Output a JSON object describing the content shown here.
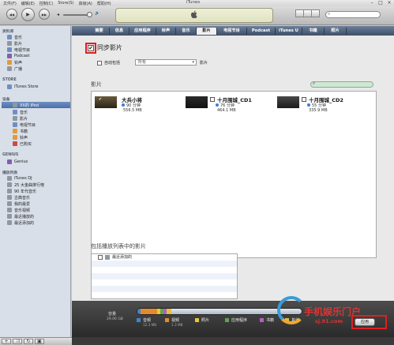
{
  "menu": {
    "items": [
      "文件(F)",
      "编辑(E)",
      "控制(C)",
      "Store(S)",
      "高级(A)",
      "帮助(H)"
    ],
    "window_title": "iTunes"
  },
  "window_controls": [
    "–",
    "□",
    "×"
  ],
  "toolbar": {
    "prev_icon": "◀◀",
    "play_icon": "▶",
    "next_icon": "▶▶",
    "vol_low_icon": "◂",
    "vol_high_icon": "🔊",
    "volume_level": 0.8,
    "search_icon": "⌕",
    "apple_logo": ""
  },
  "sidebar": {
    "sections": [
      {
        "head": "资料库",
        "items": [
          {
            "label": "音乐",
            "icon": "music-icon",
            "color": "#6e8fc2"
          },
          {
            "label": "影片",
            "icon": "film-icon",
            "color": "#8e98a2"
          },
          {
            "label": "电视节目",
            "icon": "tv-icon",
            "color": "#5a6a7e"
          },
          {
            "label": "Podcast",
            "icon": "podcast-icon",
            "color": "#8160b0"
          },
          {
            "label": "铃声",
            "icon": "bell-icon",
            "color": "#e2a93c"
          },
          {
            "label": "广播",
            "icon": "radio-icon",
            "color": "#8e98a2"
          }
        ]
      },
      {
        "head": "STORE",
        "items": [
          {
            "label": "iTunes Store",
            "icon": "store-icon",
            "color": "#6e8fc2"
          }
        ]
      },
      {
        "head": "设备",
        "device": "XX的 iPod",
        "items": [
          {
            "label": "音乐",
            "icon": "music-icon",
            "color": "#6e8fc2"
          },
          {
            "label": "影片",
            "icon": "film-icon",
            "color": "#8e98a2"
          },
          {
            "label": "电视节目",
            "icon": "tv-icon",
            "color": "#5a6a7e"
          },
          {
            "label": "书籍",
            "icon": "book-icon",
            "color": "#e29a3c"
          },
          {
            "label": "铃声",
            "icon": "bell-icon",
            "color": "#e2a93c"
          },
          {
            "label": "已购买",
            "icon": "purchased-icon",
            "color": "#d0484a"
          }
        ]
      },
      {
        "head": "GENIUS",
        "items": [
          {
            "label": "Genius",
            "icon": "genius-icon",
            "color": "#8160b0"
          }
        ]
      },
      {
        "head": "播放列表",
        "items": [
          {
            "label": "iTunes DJ",
            "icon": "dj-icon",
            "color": "#8e98a2"
          },
          {
            "label": "25 大金曲排行榜",
            "icon": "smart-playlist-icon",
            "color": "#8e98a2"
          },
          {
            "label": "90 年代音乐",
            "icon": "smart-playlist-icon",
            "color": "#8e98a2"
          },
          {
            "label": "古典音乐",
            "icon": "smart-playlist-icon",
            "color": "#8e98a2"
          },
          {
            "label": "我的最爱",
            "icon": "smart-playlist-icon",
            "color": "#8e98a2"
          },
          {
            "label": "音乐视频",
            "icon": "smart-playlist-icon",
            "color": "#8e98a2"
          },
          {
            "label": "最近播放的",
            "icon": "smart-playlist-icon",
            "color": "#8e98a2"
          },
          {
            "label": "最近添加的",
            "icon": "smart-playlist-icon",
            "color": "#8e98a2"
          }
        ]
      }
    ],
    "bottom_buttons": [
      "+",
      "⤨",
      "↻",
      "▣"
    ]
  },
  "tabs": [
    "摘要",
    "信息",
    "应用程序",
    "铃声",
    "音乐",
    "影片",
    "电视节目",
    "Podcast",
    "iTunes U",
    "书籍",
    "照片"
  ],
  "active_tab_index": 5,
  "sync": {
    "checkbox_mark": "✔",
    "label": "同步影片",
    "auto_include_label": "自动包括",
    "auto_include_select": "所有",
    "select_arrow": "▾",
    "movies_word": "影片"
  },
  "movies_section": {
    "heading": "影片",
    "search_icon": "⌕",
    "items": [
      {
        "title": "大兵小将",
        "duration": "90 分钟",
        "size": "556.5 MB",
        "checked": true,
        "mark": "✔"
      },
      {
        "title": "十月围城_CD1",
        "duration": "76 分钟",
        "size": "464.1 MB",
        "checked": false,
        "mark": ""
      },
      {
        "title": "十月围城_CD2",
        "duration": "55 分钟",
        "size": "335.9 MB",
        "checked": false,
        "mark": ""
      }
    ]
  },
  "playlists_section": {
    "heading": "包括播放列表中的影片",
    "items": [
      "最近添加的"
    ]
  },
  "capacity": {
    "label": "容量",
    "total": "29.06 GB",
    "segments": [
      {
        "name": "音频",
        "value": "12.3 MB",
        "color": "#3c84d6",
        "fraction": 0.02
      },
      {
        "name": "视频",
        "value": "1.3 MB",
        "color": "#e08c2e",
        "fraction": 0.1
      },
      {
        "name": "照片",
        "value": "",
        "color": "#e8c832",
        "fraction": 0.02
      },
      {
        "name": "应用程序",
        "value": "",
        "color": "#5aa84c",
        "fraction": 0.02
      },
      {
        "name": "书籍",
        "value": "",
        "color": "#b460c0",
        "fraction": 0.02
      },
      {
        "name": "其他",
        "value": "",
        "color": "#e0c040",
        "fraction": 0.03
      }
    ],
    "apply_label": "应用"
  },
  "watermark": {
    "text": "手机娱乐门户",
    "url": "sj.91.com"
  }
}
